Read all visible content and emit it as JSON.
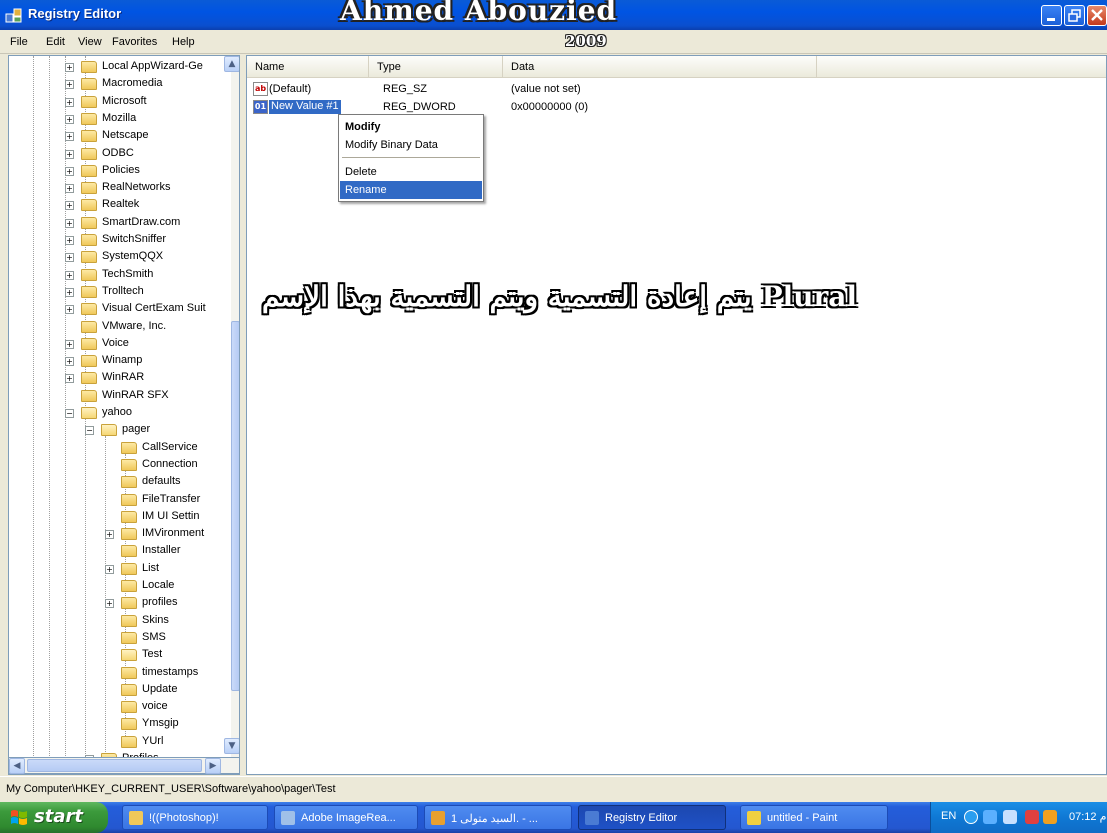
{
  "window": {
    "title": "Registry Editor",
    "watermark": "Ahmed Abouzied",
    "watermark_year": "2009"
  },
  "menu": [
    "File",
    "Edit",
    "View",
    "Favorites",
    "Help"
  ],
  "tree": {
    "items": [
      {
        "label": "Local AppWizard-Ge",
        "expander": "+"
      },
      {
        "label": "Macromedia",
        "expander": "+"
      },
      {
        "label": "Microsoft",
        "expander": "+"
      },
      {
        "label": "Mozilla",
        "expander": "+"
      },
      {
        "label": "Netscape",
        "expander": "+"
      },
      {
        "label": "ODBC",
        "expander": "+"
      },
      {
        "label": "Policies",
        "expander": "+"
      },
      {
        "label": "RealNetworks",
        "expander": "+"
      },
      {
        "label": "Realtek",
        "expander": "+"
      },
      {
        "label": "SmartDraw.com",
        "expander": "+"
      },
      {
        "label": "SwitchSniffer",
        "expander": "+"
      },
      {
        "label": "SystemQQX",
        "expander": "+"
      },
      {
        "label": "TechSmith",
        "expander": "+"
      },
      {
        "label": "Trolltech",
        "expander": "+"
      },
      {
        "label": "Visual CertExam Suit",
        "expander": "+"
      },
      {
        "label": "VMware, Inc.",
        "expander": ""
      },
      {
        "label": "Voice",
        "expander": "+"
      },
      {
        "label": "Winamp",
        "expander": "+"
      },
      {
        "label": "WinRAR",
        "expander": "+"
      },
      {
        "label": "WinRAR SFX",
        "expander": ""
      },
      {
        "label": "yahoo",
        "expander": "−"
      },
      {
        "label": "pager",
        "expander": "−"
      },
      {
        "label": "CallService",
        "expander": ""
      },
      {
        "label": "Connection",
        "expander": ""
      },
      {
        "label": "defaults",
        "expander": ""
      },
      {
        "label": "FileTransfer",
        "expander": ""
      },
      {
        "label": "IM UI Settin",
        "expander": ""
      },
      {
        "label": "IMVironment",
        "expander": "+"
      },
      {
        "label": "Installer",
        "expander": ""
      },
      {
        "label": "List",
        "expander": "+"
      },
      {
        "label": "Locale",
        "expander": ""
      },
      {
        "label": "profiles",
        "expander": "+"
      },
      {
        "label": "Skins",
        "expander": ""
      },
      {
        "label": "SMS",
        "expander": ""
      },
      {
        "label": "Test",
        "expander": ""
      },
      {
        "label": "timestamps",
        "expander": ""
      },
      {
        "label": "Update",
        "expander": ""
      },
      {
        "label": "voice",
        "expander": ""
      },
      {
        "label": "Ymsgip",
        "expander": ""
      },
      {
        "label": "YUrl",
        "expander": ""
      },
      {
        "label": "Profiles",
        "expander": "+"
      }
    ]
  },
  "list": {
    "columns": [
      "Name",
      "Type",
      "Data"
    ],
    "rows": [
      {
        "name": "(Default)",
        "type": "REG_SZ",
        "data": "(value not set)",
        "icon": "ab"
      },
      {
        "name": "New Value #1",
        "type": "REG_DWORD",
        "data": "0x00000000 (0)",
        "icon": "dword"
      }
    ]
  },
  "context_menu": {
    "items": [
      "Modify",
      "Modify Binary Data",
      "Delete",
      "Rename"
    ]
  },
  "annotation": "يتم إعادة التسمية ويتم التسمية بهذا الإسم Plural",
  "status_path": "My Computer\\HKEY_CURRENT_USER\\Software\\yahoo\\pager\\Test",
  "taskbar": {
    "start": "start",
    "tasks": [
      "!((Photoshop)!",
      "Adobe ImageRea...",
      "السيد متولى 1. - ...",
      "Registry Editor",
      "untitled - Paint"
    ],
    "lang": "EN",
    "time": "07:12 م"
  }
}
